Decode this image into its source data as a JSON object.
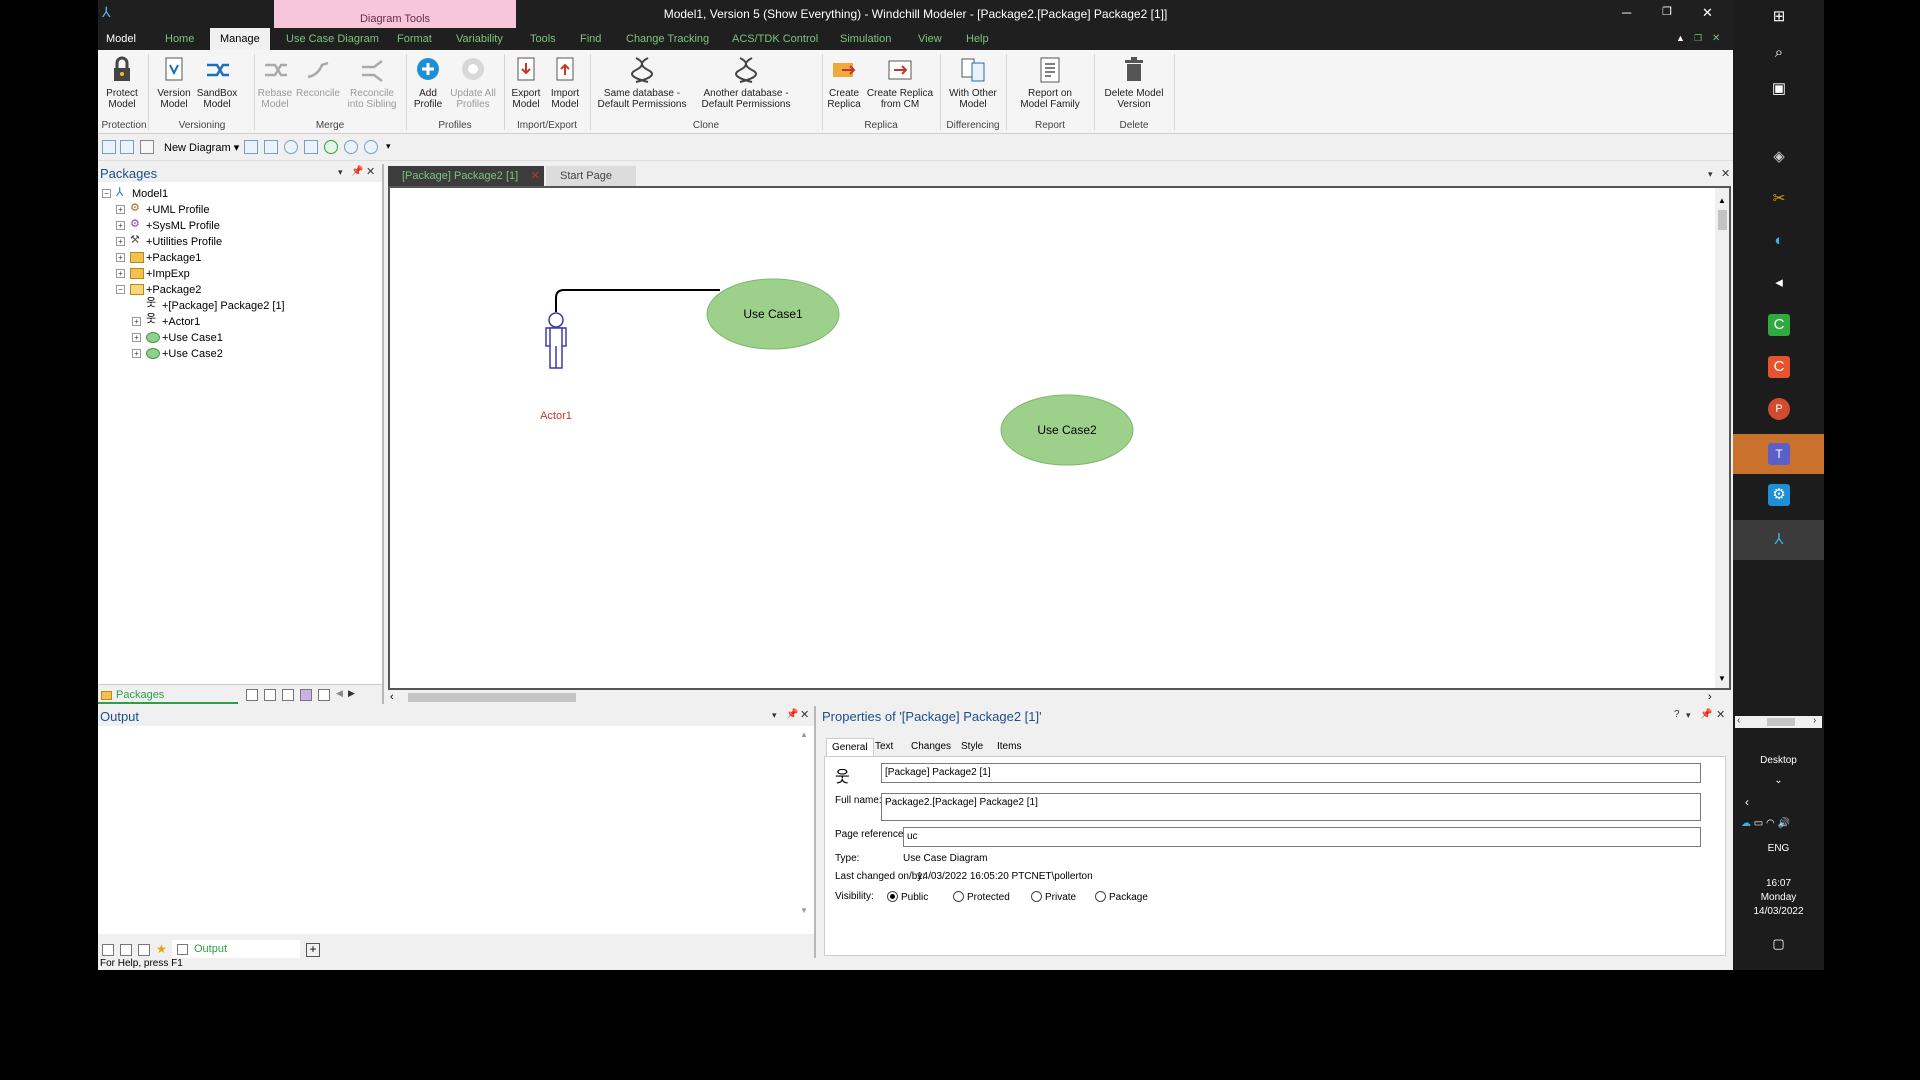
{
  "titlebar": {
    "title": "Model1, Version 5  (Show Everything) - Windchill Modeler - [Package2.[Package] Package2 [1]]",
    "context_tab": "Diagram Tools"
  },
  "ribbon_tabs": [
    "Model",
    "Home",
    "Manage",
    "Use Case Diagram",
    "Format",
    "Variability",
    "Tools",
    "Find",
    "Change Tracking",
    "ACS/TDK Control",
    "Simulation",
    "View",
    "Help"
  ],
  "ribbon_active": "Manage",
  "ribbon": {
    "protect": "Protect\nModel",
    "version": "Version\nModel",
    "sandbox": "SandBox\nModel",
    "rebase": "Rebase\nModel",
    "reconcile": "Reconcile",
    "reconcile_sibling": "Reconcile\ninto Sibling",
    "add_profile": "Add\nProfile",
    "update_profiles": "Update All\nProfiles",
    "export_model": "Export\nModel",
    "import_model": "Import\nModel",
    "same_db": "Same database -\nDefault Permissions",
    "another_db": "Another database -\nDefault Permissions",
    "create_replica": "Create\nReplica",
    "create_replica_cm": "Create Replica\nfrom CM",
    "with_other": "With Other\nModel",
    "report_family": "Report on\nModel Family",
    "delete_version": "Delete Model\nVersion",
    "groups": [
      "Protection",
      "Versioning",
      "Merge",
      "Profiles",
      "Import/Export",
      "Clone",
      "Replica",
      "Differencing",
      "Report",
      "Delete"
    ]
  },
  "toolbar": {
    "new_diagram": "New Diagram"
  },
  "packages_panel": {
    "title": "Packages",
    "footer_tab": "Packages",
    "tree": [
      {
        "label": "Model1",
        "level": 0
      },
      {
        "label": "+UML Profile",
        "level": 1
      },
      {
        "label": "+SysML Profile",
        "level": 1
      },
      {
        "label": "+Utilities Profile",
        "level": 1
      },
      {
        "label": "+Package1",
        "level": 1
      },
      {
        "label": "+ImpExp",
        "level": 1
      },
      {
        "label": "+Package2",
        "level": 1
      },
      {
        "label": "+[Package] Package2 [1]",
        "level": 2
      },
      {
        "label": "+Actor1",
        "level": 2
      },
      {
        "label": "+Use Case1",
        "level": 2
      },
      {
        "label": "+Use Case2",
        "level": 2
      }
    ]
  },
  "doc_tabs": [
    "[Package] Package2 [1]",
    "Start Page"
  ],
  "diagram": {
    "actor": "Actor1",
    "use_case1": "Use Case1",
    "use_case2": "Use Case2"
  },
  "output_panel": {
    "title": "Output",
    "footer_tab": "Output"
  },
  "properties": {
    "title": "Properties of '[Package] Package2 [1]'",
    "tabs": [
      "General",
      "Text",
      "Changes",
      "Style",
      "Items"
    ],
    "name_value": "[Package] Package2 [1]",
    "full_name_label": "Full name:",
    "full_name_value": "Package2.[Package] Package2 [1]",
    "page_ref_label": "Page reference:",
    "page_ref_value": "uc",
    "type_label": "Type:",
    "type_value": "Use Case Diagram",
    "last_changed_label": "Last changed on/by:",
    "last_changed_value": "14/03/2022 16:05:20   PTCNET\\pollerton",
    "visibility_label": "Visibility:",
    "visibility_options": [
      "Public",
      "Protected",
      "Private",
      "Package"
    ],
    "visibility_selected": "Public"
  },
  "statusbar": {
    "text": "For Help, press F1"
  },
  "taskbar": {
    "desktop": "Desktop",
    "lang": "ENG",
    "time": "16:07",
    "day": "Monday",
    "date": "14/03/2022"
  }
}
